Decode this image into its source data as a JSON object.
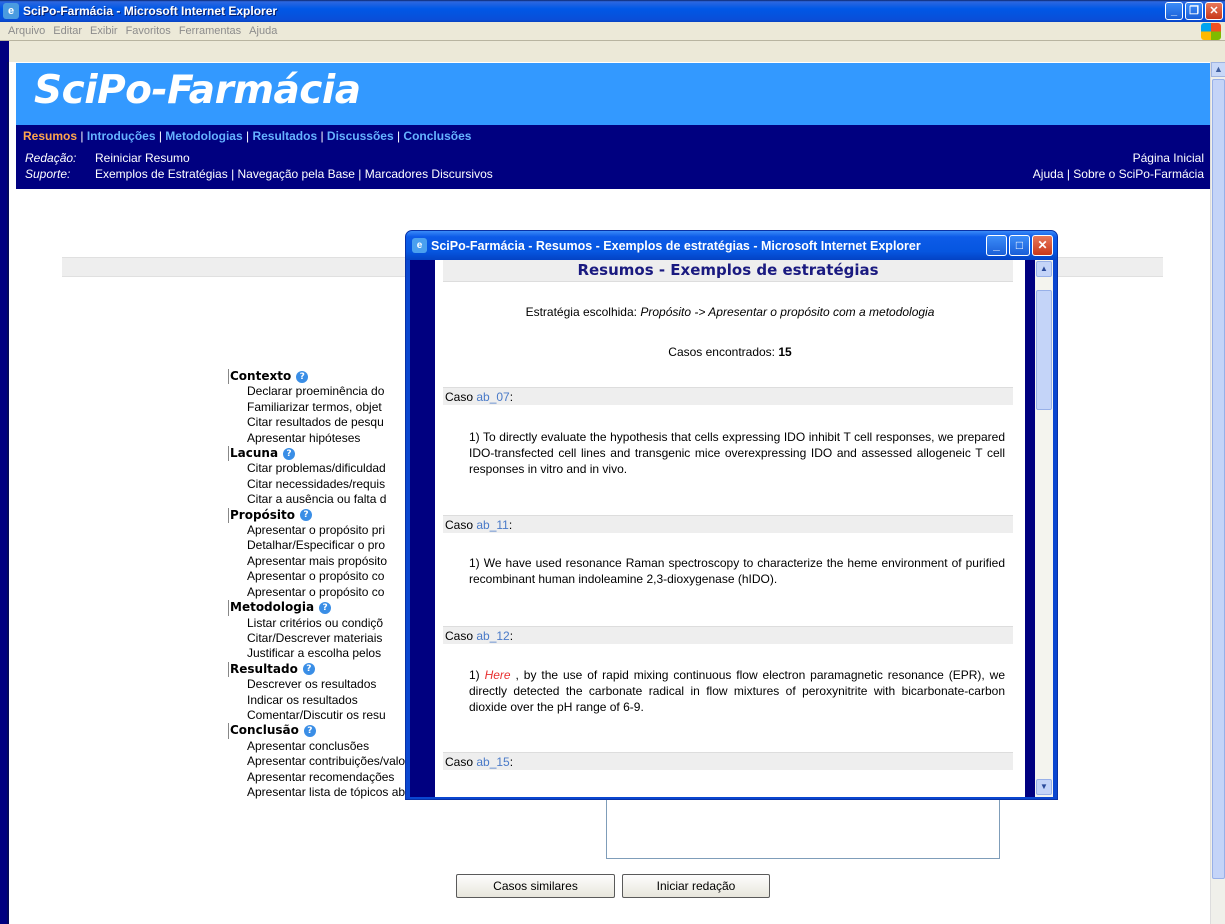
{
  "window": {
    "title": "SciPo-Farmácia - Microsoft Internet Explorer",
    "menus": [
      "Arquivo",
      "Editar",
      "Exibir",
      "Favoritos",
      "Ferramentas",
      "Ajuda"
    ]
  },
  "site": {
    "brand": "SciPo-Farmácia",
    "sections": [
      {
        "label": "Resumos",
        "active": true
      },
      {
        "label": "Introduções"
      },
      {
        "label": "Metodologias"
      },
      {
        "label": "Resultados"
      },
      {
        "label": "Discussões"
      },
      {
        "label": "Conclusões"
      }
    ],
    "redacao_label": "Redação:",
    "redacao_link": "Reiniciar Resumo",
    "suporte_label": "Suporte:",
    "suporte_links": "Exemplos de Estratégias | Navegação pela Base | Marcadores Discursivos",
    "right_top": "Página Inicial",
    "right_bottom": "Ajuda | Sobre o SciPo-Farmácia"
  },
  "tree": [
    {
      "section": "Contexto",
      "items": [
        "Declarar proeminência do",
        "Familiarizar termos, objet",
        "Citar resultados de pesqu",
        "Apresentar hipóteses"
      ]
    },
    {
      "section": "Lacuna",
      "items": [
        "Citar problemas/dificuldad",
        "Citar necessidades/requis",
        "Citar a ausência ou falta d"
      ]
    },
    {
      "section": "Propósito",
      "items": [
        "Apresentar o propósito pri",
        "Detalhar/Especificar o pro",
        "Apresentar mais propósito",
        "Apresentar o propósito co",
        "Apresentar o propósito co"
      ]
    },
    {
      "section": "Metodologia",
      "items": [
        "Listar critérios ou condiçõ",
        "Citar/Descrever materiais",
        "Justificar a escolha pelos"
      ]
    },
    {
      "section": "Resultado",
      "items": [
        "Descrever os resultados",
        "Indicar os resultados",
        "Comentar/Discutir os resu"
      ]
    },
    {
      "section": "Conclusão",
      "items": [
        "Apresentar conclusões",
        "Apresentar contribuições/valor da pesquisa",
        "Apresentar recomendações",
        "Apresentar lista de tópicos abordados no trabalho"
      ]
    }
  ],
  "buttons": {
    "similar": "Casos similares",
    "start": "Iniciar redação"
  },
  "popup": {
    "title": "SciPo-Farmácia - Resumos - Exemplos de estratégias - Microsoft Internet Explorer",
    "heading": "Resumos - Exemplos de estratégias",
    "strategy_label": "Estratégia escolhida:",
    "strategy_value": "Propósito -> Apresentar o propósito com a metodologia",
    "cases_label": "Casos encontrados:",
    "cases_count": "15",
    "case_word": "Caso",
    "cases": [
      {
        "id": "ab_07",
        "text": "1) To directly evaluate the hypothesis that cells expressing IDO inhibit T cell responses, we prepared IDO-transfected cell lines and transgenic mice overexpressing IDO and assessed allogeneic T cell responses in vitro and in vivo."
      },
      {
        "id": "ab_11",
        "text": "1) We have used resonance Raman spectroscopy to characterize the heme environment of purified recombinant human indoleamine 2,3-dioxygenase (hIDO)."
      },
      {
        "id": "ab_12",
        "prefix": "1) ",
        "marker": "Here",
        "text": " , by the use of rapid mixing continuous flow electron paramagnetic resonance (EPR), we directly detected the carbonate radical in flow mixtures of peroxynitrite with bicarbonate-carbon dioxide over the pH range of 6-9."
      },
      {
        "id": "ab_15",
        "text": ""
      }
    ]
  }
}
